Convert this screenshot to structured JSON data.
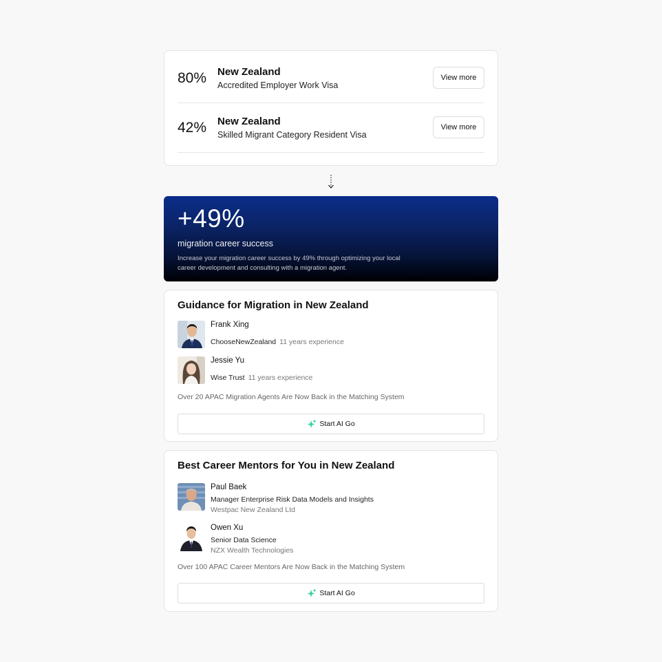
{
  "visas": [
    {
      "percent": "80%",
      "country": "New Zealand",
      "visa": "Accredited Employer Work Visa",
      "button": "View more"
    },
    {
      "percent": "42%",
      "country": "New Zealand",
      "visa": "Skilled Migrant Category Resident Visa",
      "button": "View more"
    }
  ],
  "banner": {
    "value": "+49%",
    "label": "migration career success",
    "description": "Increase your migration career success by 49% through optimizing your local career development and consulting with a migration agent."
  },
  "guidance": {
    "title": "Guidance for Migration in New Zealand",
    "agents": [
      {
        "name": "Frank Xing",
        "org": "ChooseNewZealand",
        "experience": "11 years experience"
      },
      {
        "name": "Jessie Yu",
        "org": "Wise Trust",
        "experience": "11 years experience"
      }
    ],
    "footnote": "Over 20 APAC Migration Agents Are Now Back in the Matching System",
    "button": "Start AI Go"
  },
  "mentors": {
    "title": "Best Career Mentors for You in New Zealand",
    "people": [
      {
        "name": "Paul Baek",
        "role": "Manager Enterprise Risk Data Models and Insights",
        "company": "Westpac New Zealand Ltd"
      },
      {
        "name": "Owen Xu",
        "role": "Senior Data Science",
        "company": "NZX Wealth Technologies"
      }
    ],
    "footnote": "Over 100 APAC Career Mentors Are Now Back in the Matching System",
    "button": "Start AI Go"
  },
  "icons": {
    "sparkle": "sparkle-icon",
    "connector": "dotted-arrow-down-icon"
  },
  "colors": {
    "accent_sparkle": "#2fd39b",
    "banner_top": "#0a2d8a",
    "banner_bottom": "#000004"
  }
}
